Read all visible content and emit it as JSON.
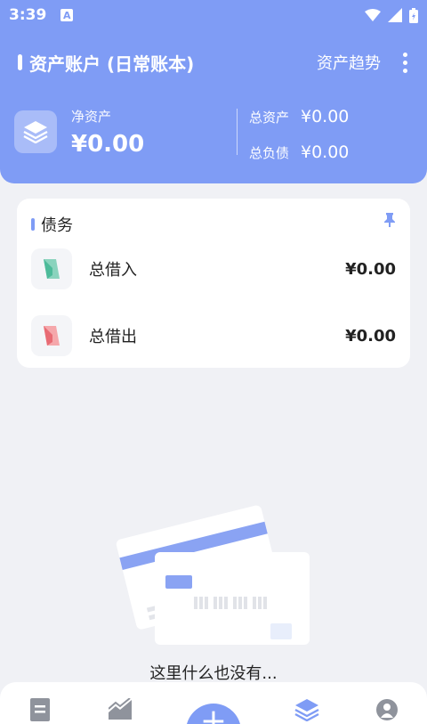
{
  "status_bar": {
    "time": "3:39",
    "notification": "A"
  },
  "header": {
    "title": "资产账户 (日常账本)",
    "trend_label": "资产趋势",
    "net_assets_label": "净资产",
    "net_assets_value": "¥0.00",
    "total_assets_label": "总资产",
    "total_assets_value": "¥0.00",
    "total_liabilities_label": "总负债",
    "total_liabilities_value": "¥0.00"
  },
  "debt_card": {
    "title": "债务",
    "items": [
      {
        "label": "总借入",
        "amount": "¥0.00",
        "icon": "borrow-in-icon"
      },
      {
        "label": "总借出",
        "amount": "¥0.00",
        "icon": "lend-out-icon"
      }
    ]
  },
  "empty_state": {
    "text": "这里什么也没有..."
  },
  "bottom_nav": {
    "items": [
      "ledger-icon",
      "chart-icon",
      "add-button",
      "assets-icon",
      "profile-icon"
    ],
    "add_label": "+"
  },
  "colors": {
    "accent": "#7f9cf5",
    "background": "#f0f1f5"
  }
}
